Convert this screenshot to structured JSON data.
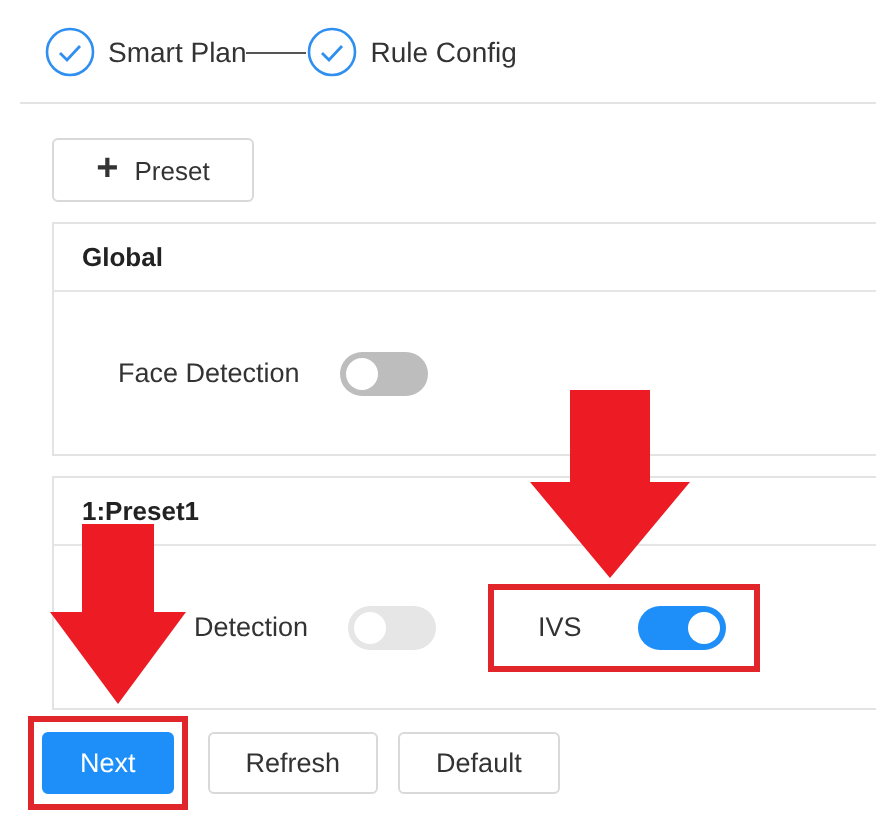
{
  "steps": [
    {
      "label": "Smart Plan",
      "done": true
    },
    {
      "label": "Rule Config",
      "done": true
    }
  ],
  "add_button": {
    "icon": "+",
    "label": "Preset"
  },
  "panels": [
    {
      "title": "Global",
      "items": [
        {
          "label": "Face Detection",
          "on": false,
          "disabled": false,
          "highlighted": false
        }
      ]
    },
    {
      "title": "1:Preset1",
      "items": [
        {
          "label": "Detection",
          "on": false,
          "disabled": true,
          "highlighted": false
        },
        {
          "label": "IVS",
          "on": true,
          "disabled": false,
          "highlighted": true
        }
      ]
    }
  ],
  "buttons": [
    {
      "label": "Next",
      "primary": true,
      "highlighted": true
    },
    {
      "label": "Refresh",
      "primary": false,
      "highlighted": false
    },
    {
      "label": "Default",
      "primary": false,
      "highlighted": false
    }
  ]
}
